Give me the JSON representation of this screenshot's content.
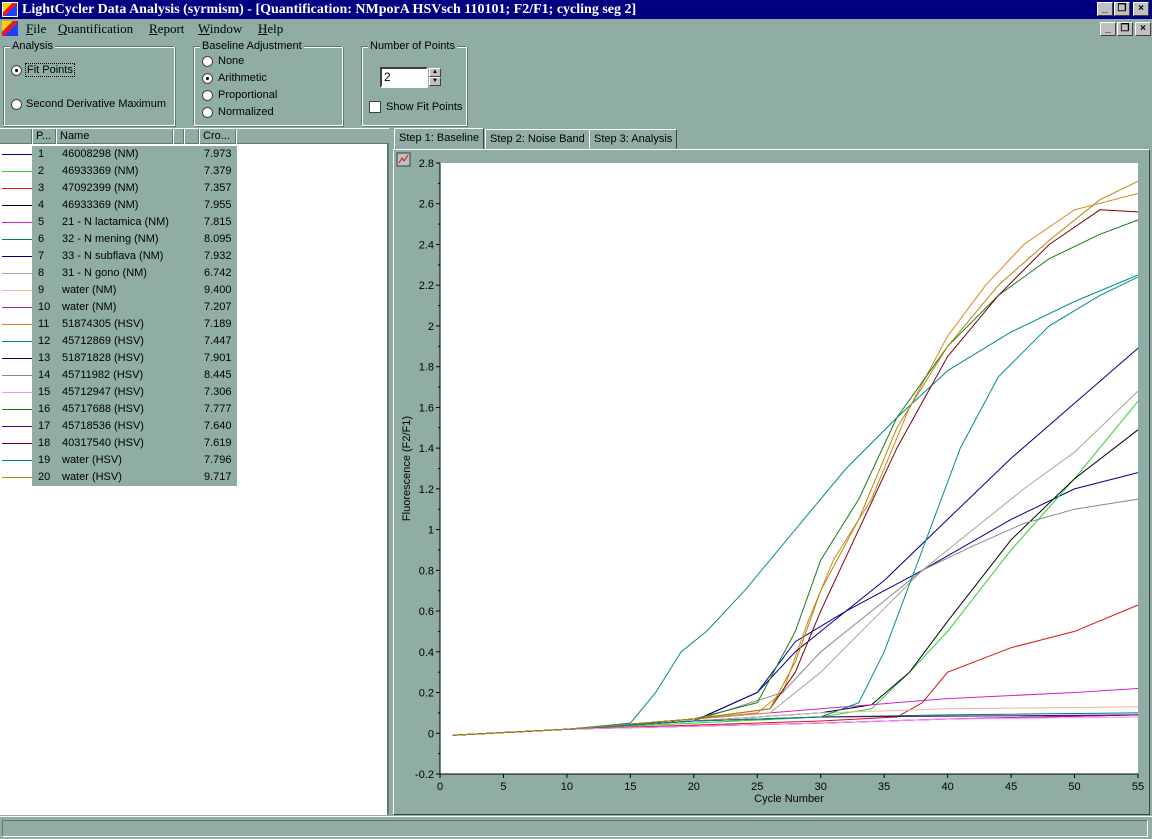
{
  "window": {
    "title": "LightCycler Data Analysis (syrmism)  - [Quantification: NMporA HSVsch 110101; F2/F1; cycling seg 2]",
    "min_glyph": "_",
    "restore_glyph": "❐",
    "close_glyph": "×"
  },
  "menu": [
    {
      "first": "F",
      "rest": "ile"
    },
    {
      "first": "Q",
      "rest": "uantification"
    },
    {
      "first": "R",
      "rest": "eport"
    },
    {
      "first": "W",
      "rest": "indow"
    },
    {
      "first": "H",
      "rest": "elp"
    }
  ],
  "analysis": {
    "legend": "Analysis",
    "options": [
      "Fit Points",
      "Second Derivative Maximum"
    ],
    "selected": 0
  },
  "baseline": {
    "legend": "Baseline Adjustment",
    "options": [
      "None",
      "Arithmetic",
      "Proportional",
      "Normalized"
    ],
    "selected": 1
  },
  "points": {
    "legend": "Number of Points",
    "value": "2",
    "show_fit_label": "Show Fit Points",
    "show_fit_checked": false
  },
  "list": {
    "headers": [
      "P...",
      "Name",
      "Cro..."
    ],
    "rows": [
      {
        "pos": "1",
        "name": "46008298  (NM)",
        "cp": "7.973",
        "color": "#00008b"
      },
      {
        "pos": "2",
        "name": "46933369  (NM)",
        "cp": "7.379",
        "color": "#32cd32"
      },
      {
        "pos": "3",
        "name": "47092399  (NM)",
        "cp": "7.357",
        "color": "#dd1111"
      },
      {
        "pos": "4",
        "name": "46933369  (NM)",
        "cp": "7.955",
        "color": "#000000"
      },
      {
        "pos": "5",
        "name": "21 - N lactamica  (NM)",
        "cp": "7.815",
        "color": "#cc22cc"
      },
      {
        "pos": "6",
        "name": "32 - N mening  (NM)",
        "cp": "8.095",
        "color": "#008060"
      },
      {
        "pos": "7",
        "name": "33 - N subflava  (NM)",
        "cp": "7.932",
        "color": "#00008b"
      },
      {
        "pos": "8",
        "name": "31 - N gono  (NM)",
        "cp": "6.742",
        "color": "#a8a890"
      },
      {
        "pos": "9",
        "name": "water  (NM)",
        "cp": "9.400",
        "color": "#e8b8a0"
      },
      {
        "pos": "10",
        "name": "water  (NM)",
        "cp": "7.207",
        "color": "#aa22aa"
      },
      {
        "pos": "11",
        "name": "51874305  (HSV)",
        "cp": "7.189",
        "color": "#d2881e"
      },
      {
        "pos": "12",
        "name": "45712869  (HSV)",
        "cp": "7.447",
        "color": "#008b8b"
      },
      {
        "pos": "13",
        "name": "51871828  (HSV)",
        "cp": "7.901",
        "color": "#000080"
      },
      {
        "pos": "14",
        "name": "45711982  (HSV)",
        "cp": "8.445",
        "color": "#888888"
      },
      {
        "pos": "15",
        "name": "45712947  (HSV)",
        "cp": "7.306",
        "color": "#ff88ff"
      },
      {
        "pos": "16",
        "name": "45717688  (HSV)",
        "cp": "7.777",
        "color": "#1a7a1a"
      },
      {
        "pos": "17",
        "name": "45718536  (HSV)",
        "cp": "7.640",
        "color": "#4b0082"
      },
      {
        "pos": "18",
        "name": "40317540  (HSV)",
        "cp": "7.619",
        "color": "#800000"
      },
      {
        "pos": "19",
        "name": "water  (HSV)",
        "cp": "7.796",
        "color": "#008b8b"
      },
      {
        "pos": "20",
        "name": "water  (HSV)",
        "cp": "9.717",
        "color": "#b8860b"
      }
    ]
  },
  "tabs": [
    "Step 1: Baseline",
    "Step 2: Noise Band",
    "Step 3: Analysis"
  ],
  "active_tab": 0,
  "chart_data": {
    "type": "line",
    "xlabel": "Cycle Number",
    "ylabel": "Fluorescence (F2/F1)",
    "xlim": [
      0,
      55
    ],
    "ylim": [
      -0.2,
      2.8
    ],
    "xticks": [
      0,
      5,
      10,
      15,
      20,
      25,
      30,
      35,
      40,
      45,
      50,
      55
    ],
    "yticks": [
      -0.2,
      0,
      0.2,
      0.4,
      0.6,
      0.8,
      1,
      1.2,
      1.4,
      1.6,
      1.8,
      2,
      2.2,
      2.4,
      2.6,
      2.8
    ],
    "ytick_labels": [
      "-0.2",
      "0",
      "0.2",
      "0.4",
      "0.6",
      "0.8",
      "1",
      "1.2",
      "1.4",
      "1.6",
      "1.8",
      "2",
      "2.2",
      "2.4",
      "2.6",
      "2.8"
    ],
    "series": [
      {
        "color": "#00008b",
        "points": [
          [
            1,
            -0.01
          ],
          [
            10,
            0.02
          ],
          [
            20,
            0.06
          ],
          [
            25,
            0.2
          ],
          [
            28,
            0.45
          ],
          [
            32,
            0.6
          ],
          [
            38,
            0.8
          ],
          [
            45,
            1.05
          ],
          [
            50,
            1.2
          ],
          [
            55,
            1.28
          ]
        ]
      },
      {
        "color": "#32cd32",
        "points": [
          [
            1,
            -0.01
          ],
          [
            10,
            0.02
          ],
          [
            20,
            0.05
          ],
          [
            30,
            0.08
          ],
          [
            34,
            0.12
          ],
          [
            37,
            0.3
          ],
          [
            40,
            0.5
          ],
          [
            45,
            0.9
          ],
          [
            50,
            1.25
          ],
          [
            55,
            1.63
          ]
        ]
      },
      {
        "color": "#dd1111",
        "points": [
          [
            1,
            -0.01
          ],
          [
            10,
            0.02
          ],
          [
            30,
            0.06
          ],
          [
            36,
            0.08
          ],
          [
            38,
            0.15
          ],
          [
            40,
            0.3
          ],
          [
            45,
            0.42
          ],
          [
            50,
            0.5
          ],
          [
            55,
            0.63
          ]
        ]
      },
      {
        "color": "#000000",
        "points": [
          [
            1,
            -0.01
          ],
          [
            10,
            0.02
          ],
          [
            20,
            0.06
          ],
          [
            30,
            0.1
          ],
          [
            34,
            0.14
          ],
          [
            37,
            0.3
          ],
          [
            40,
            0.55
          ],
          [
            45,
            0.95
          ],
          [
            50,
            1.25
          ],
          [
            55,
            1.49
          ]
        ]
      },
      {
        "color": "#cc22cc",
        "points": [
          [
            1,
            -0.01
          ],
          [
            10,
            0.02
          ],
          [
            30,
            0.12
          ],
          [
            40,
            0.17
          ],
          [
            50,
            0.2
          ],
          [
            55,
            0.22
          ]
        ]
      },
      {
        "color": "#008060",
        "points": [
          [
            1,
            -0.01
          ],
          [
            10,
            0.02
          ],
          [
            20,
            0.06
          ],
          [
            30,
            0.08
          ],
          [
            40,
            0.09
          ],
          [
            55,
            0.1
          ]
        ]
      },
      {
        "color": "#00008b",
        "points": [
          [
            1,
            -0.01
          ],
          [
            10,
            0.02
          ],
          [
            30,
            0.05
          ],
          [
            40,
            0.07
          ],
          [
            55,
            0.09
          ]
        ]
      },
      {
        "color": "#a8a890",
        "points": [
          [
            1,
            -0.01
          ],
          [
            10,
            0.02
          ],
          [
            26,
            0.1
          ],
          [
            30,
            0.3
          ],
          [
            34,
            0.55
          ],
          [
            38,
            0.8
          ],
          [
            42,
            1.0
          ],
          [
            46,
            1.2
          ],
          [
            50,
            1.38
          ],
          [
            55,
            1.68
          ]
        ]
      },
      {
        "color": "#e8b8a0",
        "points": [
          [
            1,
            -0.01
          ],
          [
            10,
            0.02
          ],
          [
            30,
            0.1
          ],
          [
            40,
            0.12
          ],
          [
            55,
            0.13
          ]
        ]
      },
      {
        "color": "#aa22aa",
        "points": [
          [
            1,
            -0.01
          ],
          [
            10,
            0.02
          ],
          [
            30,
            0.05
          ],
          [
            40,
            0.07
          ],
          [
            55,
            0.09
          ]
        ]
      },
      {
        "color": "#d2881e",
        "points": [
          [
            1,
            -0.01
          ],
          [
            10,
            0.02
          ],
          [
            20,
            0.07
          ],
          [
            25,
            0.1
          ],
          [
            27,
            0.2
          ],
          [
            29,
            0.55
          ],
          [
            31,
            0.85
          ],
          [
            34,
            1.15
          ],
          [
            37,
            1.6
          ],
          [
            40,
            1.95
          ],
          [
            43,
            2.2
          ],
          [
            46,
            2.4
          ],
          [
            50,
            2.57
          ],
          [
            55,
            2.65
          ]
        ]
      },
      {
        "color": "#008b8b",
        "points": [
          [
            1,
            -0.01
          ],
          [
            10,
            0.02
          ],
          [
            15,
            0.05
          ],
          [
            17,
            0.2
          ],
          [
            19,
            0.4
          ],
          [
            21,
            0.5
          ],
          [
            24,
            0.7
          ],
          [
            28,
            1.0
          ],
          [
            32,
            1.3
          ],
          [
            36,
            1.55
          ],
          [
            40,
            1.78
          ],
          [
            45,
            1.97
          ],
          [
            50,
            2.12
          ],
          [
            55,
            2.25
          ]
        ]
      },
      {
        "color": "#000080",
        "points": [
          [
            1,
            -0.01
          ],
          [
            10,
            0.02
          ],
          [
            20,
            0.06
          ],
          [
            25,
            0.2
          ],
          [
            28,
            0.4
          ],
          [
            30,
            0.5
          ],
          [
            35,
            0.75
          ],
          [
            40,
            1.05
          ],
          [
            45,
            1.35
          ],
          [
            50,
            1.62
          ],
          [
            55,
            1.89
          ]
        ]
      },
      {
        "color": "#888888",
        "points": [
          [
            1,
            -0.01
          ],
          [
            10,
            0.02
          ],
          [
            20,
            0.06
          ],
          [
            27,
            0.2
          ],
          [
            30,
            0.4
          ],
          [
            34,
            0.6
          ],
          [
            38,
            0.8
          ],
          [
            42,
            0.92
          ],
          [
            46,
            1.03
          ],
          [
            50,
            1.1
          ],
          [
            55,
            1.15
          ]
        ]
      },
      {
        "color": "#ff88ff",
        "points": [
          [
            1,
            -0.01
          ],
          [
            10,
            0.02
          ],
          [
            30,
            0.05
          ],
          [
            40,
            0.07
          ],
          [
            55,
            0.08
          ]
        ]
      },
      {
        "color": "#1a7a1a",
        "points": [
          [
            1,
            -0.01
          ],
          [
            10,
            0.02
          ],
          [
            20,
            0.07
          ],
          [
            25,
            0.15
          ],
          [
            28,
            0.5
          ],
          [
            30,
            0.85
          ],
          [
            33,
            1.15
          ],
          [
            36,
            1.55
          ],
          [
            40,
            1.9
          ],
          [
            44,
            2.15
          ],
          [
            48,
            2.33
          ],
          [
            52,
            2.45
          ],
          [
            55,
            2.52
          ]
        ]
      },
      {
        "color": "#4b0082",
        "points": [
          [
            1,
            -0.01
          ],
          [
            10,
            0.02
          ],
          [
            20,
            0.06
          ],
          [
            30,
            0.08
          ],
          [
            55,
            0.09
          ]
        ]
      },
      {
        "color": "#800000",
        "points": [
          [
            1,
            -0.01
          ],
          [
            10,
            0.02
          ],
          [
            20,
            0.07
          ],
          [
            26,
            0.12
          ],
          [
            28,
            0.3
          ],
          [
            30,
            0.6
          ],
          [
            33,
            1.0
          ],
          [
            36,
            1.4
          ],
          [
            40,
            1.85
          ],
          [
            44,
            2.15
          ],
          [
            48,
            2.4
          ],
          [
            52,
            2.57
          ],
          [
            55,
            2.56
          ]
        ]
      },
      {
        "color": "#008b8b",
        "points": [
          [
            1,
            -0.01
          ],
          [
            10,
            0.02
          ],
          [
            20,
            0.06
          ],
          [
            30,
            0.08
          ],
          [
            33,
            0.15
          ],
          [
            35,
            0.4
          ],
          [
            38,
            0.9
          ],
          [
            41,
            1.4
          ],
          [
            44,
            1.75
          ],
          [
            48,
            2.0
          ],
          [
            52,
            2.15
          ],
          [
            55,
            2.24
          ]
        ]
      },
      {
        "color": "#b8860b",
        "points": [
          [
            1,
            -0.01
          ],
          [
            10,
            0.02
          ],
          [
            20,
            0.07
          ],
          [
            26,
            0.12
          ],
          [
            28,
            0.35
          ],
          [
            30,
            0.7
          ],
          [
            33,
            1.05
          ],
          [
            36,
            1.5
          ],
          [
            40,
            1.9
          ],
          [
            44,
            2.2
          ],
          [
            48,
            2.42
          ],
          [
            52,
            2.62
          ],
          [
            55,
            2.71
          ]
        ]
      }
    ]
  }
}
